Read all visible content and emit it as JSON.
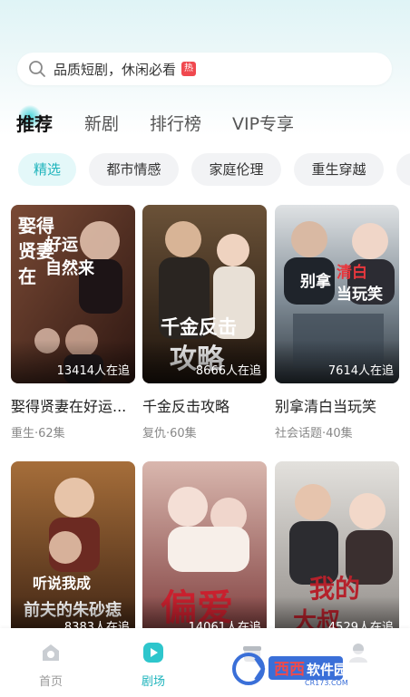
{
  "search": {
    "placeholder_text": "品质短剧，休闲必看",
    "badge": "热"
  },
  "tabs": [
    {
      "label": "推荐",
      "active": true
    },
    {
      "label": "新剧",
      "active": false
    },
    {
      "label": "排行榜",
      "active": false
    },
    {
      "label": "VIP专享",
      "active": false
    }
  ],
  "chips": [
    {
      "label": "精选",
      "active": true
    },
    {
      "label": "都市情感",
      "active": false
    },
    {
      "label": "家庭伦理",
      "active": false
    },
    {
      "label": "重生穿越",
      "active": false
    }
  ],
  "dramas": [
    {
      "title": "娶得贤妻在好运...",
      "tags": "重生·62集",
      "followers": "13414人在追",
      "poster_text": "娶得贤妻在 好运自然来",
      "poster_color": "#5a2e22"
    },
    {
      "title": "千金反击攻略",
      "tags": "复仇·60集",
      "followers": "8666人在追",
      "poster_text": "千金反击 攻略",
      "poster_color": "#3b2a1c"
    },
    {
      "title": "别拿清白当玩笑",
      "tags": "社会话题·40集",
      "followers": "7614人在追",
      "poster_text": "别拿清白 当玩笑",
      "poster_color": "#4d5a63"
    },
    {
      "title": "",
      "tags": "",
      "followers": "8383人在追",
      "poster_text": "听说我成 前夫的朱砂痣",
      "poster_color": "#6b4428"
    },
    {
      "title": "",
      "tags": "",
      "followers": "14061人在追",
      "poster_text": "偏爱",
      "poster_color": "#b98c86"
    },
    {
      "title": "",
      "tags": "",
      "followers": "4529人在追",
      "poster_text": "我的大叔",
      "poster_color": "#b7b4b0"
    }
  ],
  "bottom_nav": [
    {
      "label": "首页",
      "icon": "home-icon",
      "active": false
    },
    {
      "label": "剧场",
      "icon": "play-icon",
      "active": true
    },
    {
      "label": "",
      "icon": "gift-icon",
      "active": false
    },
    {
      "label": "",
      "icon": "profile-icon",
      "active": false
    }
  ],
  "watermark": {
    "brand": "西西软件园",
    "url": "CR173.COM"
  },
  "colors": {
    "accent": "#1fb4bc",
    "chip_active_bg": "#e4f8f9",
    "hot_badge": "#f0494f"
  }
}
